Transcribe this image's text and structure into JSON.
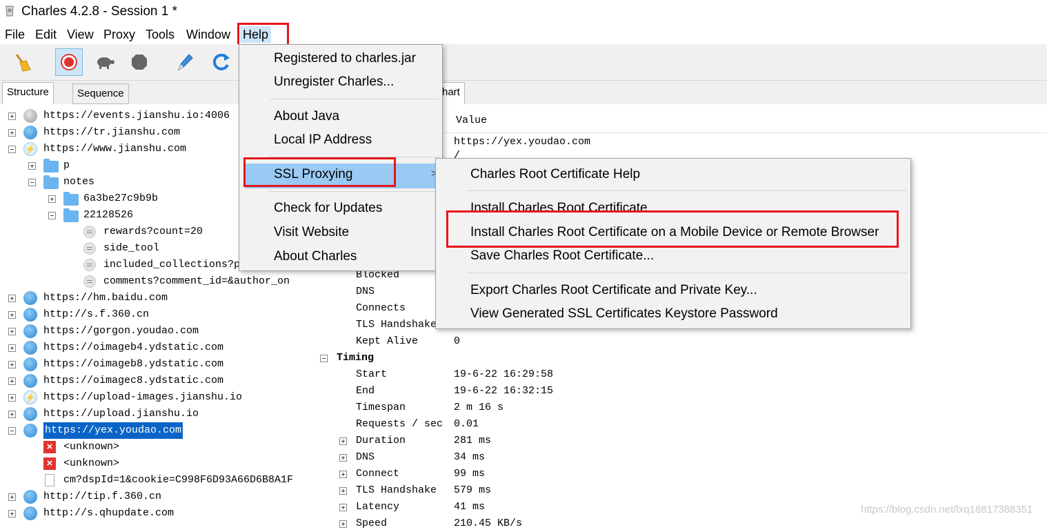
{
  "window": {
    "title": "Charles 4.2.8 - Session 1 *"
  },
  "menubar": [
    "File",
    "Edit",
    "View",
    "Proxy",
    "Tools",
    "Window",
    "Help"
  ],
  "toolbar": [
    "broom-icon",
    "record-icon",
    "turtle-icon",
    "stop-icon",
    "pen-icon",
    "refresh-icon"
  ],
  "left_tabs": [
    "Structure",
    "Sequence"
  ],
  "tree": [
    {
      "label": "https://events.jianshu.io:4006",
      "icon": "lock-globe",
      "depth": 0,
      "exp": "plus"
    },
    {
      "label": "https://tr.jianshu.com",
      "icon": "globe",
      "depth": 0,
      "exp": "plus"
    },
    {
      "label": "https://www.jianshu.com",
      "icon": "bolt-globe",
      "depth": 0,
      "exp": "minus"
    },
    {
      "label": "p",
      "icon": "folder",
      "depth": 1,
      "exp": "plus"
    },
    {
      "label": "notes",
      "icon": "folder",
      "depth": 1,
      "exp": "minus"
    },
    {
      "label": "6a3be27c9b9b",
      "icon": "folder",
      "depth": 2,
      "exp": "plus"
    },
    {
      "label": "22128526",
      "icon": "folder",
      "depth": 2,
      "exp": "minus"
    },
    {
      "label": "rewards?count=20",
      "icon": "doc",
      "depth": 3,
      "exp": ""
    },
    {
      "label": "side_tool",
      "icon": "doc",
      "depth": 3,
      "exp": ""
    },
    {
      "label": "included_collections?p",
      "icon": "doc",
      "depth": 3,
      "exp": ""
    },
    {
      "label": "comments?comment_id=&author_on",
      "icon": "doc",
      "depth": 3,
      "exp": ""
    },
    {
      "label": "https://hm.baidu.com",
      "icon": "globe",
      "depth": 0,
      "exp": "plus"
    },
    {
      "label": "http://s.f.360.cn",
      "icon": "globe",
      "depth": 0,
      "exp": "plus"
    },
    {
      "label": "https://gorgon.youdao.com",
      "icon": "globe",
      "depth": 0,
      "exp": "plus"
    },
    {
      "label": "https://oimageb4.ydstatic.com",
      "icon": "globe",
      "depth": 0,
      "exp": "plus"
    },
    {
      "label": "https://oimageb8.ydstatic.com",
      "icon": "globe",
      "depth": 0,
      "exp": "plus"
    },
    {
      "label": "https://oimagec8.ydstatic.com",
      "icon": "globe",
      "depth": 0,
      "exp": "plus"
    },
    {
      "label": "https://upload-images.jianshu.io",
      "icon": "bolt-globe",
      "depth": 0,
      "exp": "plus"
    },
    {
      "label": "https://upload.jianshu.io",
      "icon": "globe",
      "depth": 0,
      "exp": "plus"
    },
    {
      "label": "https://yex.youdao.com",
      "icon": "globe",
      "depth": 0,
      "exp": "minus",
      "selected": true
    },
    {
      "label": "<unknown>",
      "icon": "error",
      "depth": 1,
      "exp": ""
    },
    {
      "label": "<unknown>",
      "icon": "error",
      "depth": 1,
      "exp": ""
    },
    {
      "label": "cm?dspId=1&cookie=C998F6D93A66D6B8A1F",
      "icon": "file",
      "depth": 1,
      "exp": ""
    },
    {
      "label": "http://tip.f.360.cn",
      "icon": "globe",
      "depth": 0,
      "exp": "plus"
    },
    {
      "label": "http://s.qhupdate.com",
      "icon": "globe",
      "depth": 0,
      "exp": "plus"
    }
  ],
  "right": {
    "tab_partial": "hart",
    "value_header": "Value",
    "host_value": "https://yex.youdao.com",
    "path_value": "/",
    "rows": [
      {
        "label": "Blocked",
        "value": "",
        "exp": ""
      },
      {
        "label": "DNS",
        "value": "",
        "exp": ""
      },
      {
        "label": "Connects",
        "value": "",
        "exp": ""
      },
      {
        "label": "TLS Handshake",
        "value": "",
        "exp": ""
      },
      {
        "label": "Kept Alive",
        "value": "0",
        "exp": ""
      },
      {
        "label": "Timing",
        "value": "",
        "exp": "minus",
        "bold": true
      },
      {
        "label": "Start",
        "value": "19-6-22 16:29:58",
        "exp": ""
      },
      {
        "label": "End",
        "value": "19-6-22 16:32:15",
        "exp": ""
      },
      {
        "label": "Timespan",
        "value": "2 m 16 s",
        "exp": ""
      },
      {
        "label": "Requests / sec",
        "value": "0.01",
        "exp": ""
      },
      {
        "label": "Duration",
        "value": "281 ms",
        "exp": "plus"
      },
      {
        "label": "DNS",
        "value": "34 ms",
        "exp": "plus"
      },
      {
        "label": "Connect",
        "value": "99 ms",
        "exp": "plus"
      },
      {
        "label": "TLS Handshake",
        "value": "579 ms",
        "exp": "plus"
      },
      {
        "label": "Latency",
        "value": "41 ms",
        "exp": "plus"
      },
      {
        "label": "Speed",
        "value": "210.45 KB/s",
        "exp": "plus"
      }
    ]
  },
  "help_menu": {
    "groups": [
      [
        "Registered to charles.jar",
        "Unregister Charles..."
      ],
      [
        "About Java",
        "Local IP Address"
      ],
      [
        "SSL Proxying"
      ],
      [
        "Check for Updates",
        "Visit Website",
        "About Charles"
      ]
    ],
    "submenu_arrow": ">"
  },
  "ssl_submenu": {
    "groups": [
      [
        "Charles Root Certificate Help"
      ],
      [
        "Install Charles Root Certificate",
        "Install Charles Root Certificate on a Mobile Device or Remote Browser",
        "Save Charles Root Certificate..."
      ],
      [
        "Export Charles Root Certificate and Private Key...",
        "View Generated SSL Certificates Keystore Password"
      ]
    ]
  },
  "watermark": "https://blog.csdn.net/lxq18817388351",
  "colors": {
    "highlight": "#e8141b",
    "selection": "#0a64c8",
    "menu_hover": "#99caf3"
  }
}
